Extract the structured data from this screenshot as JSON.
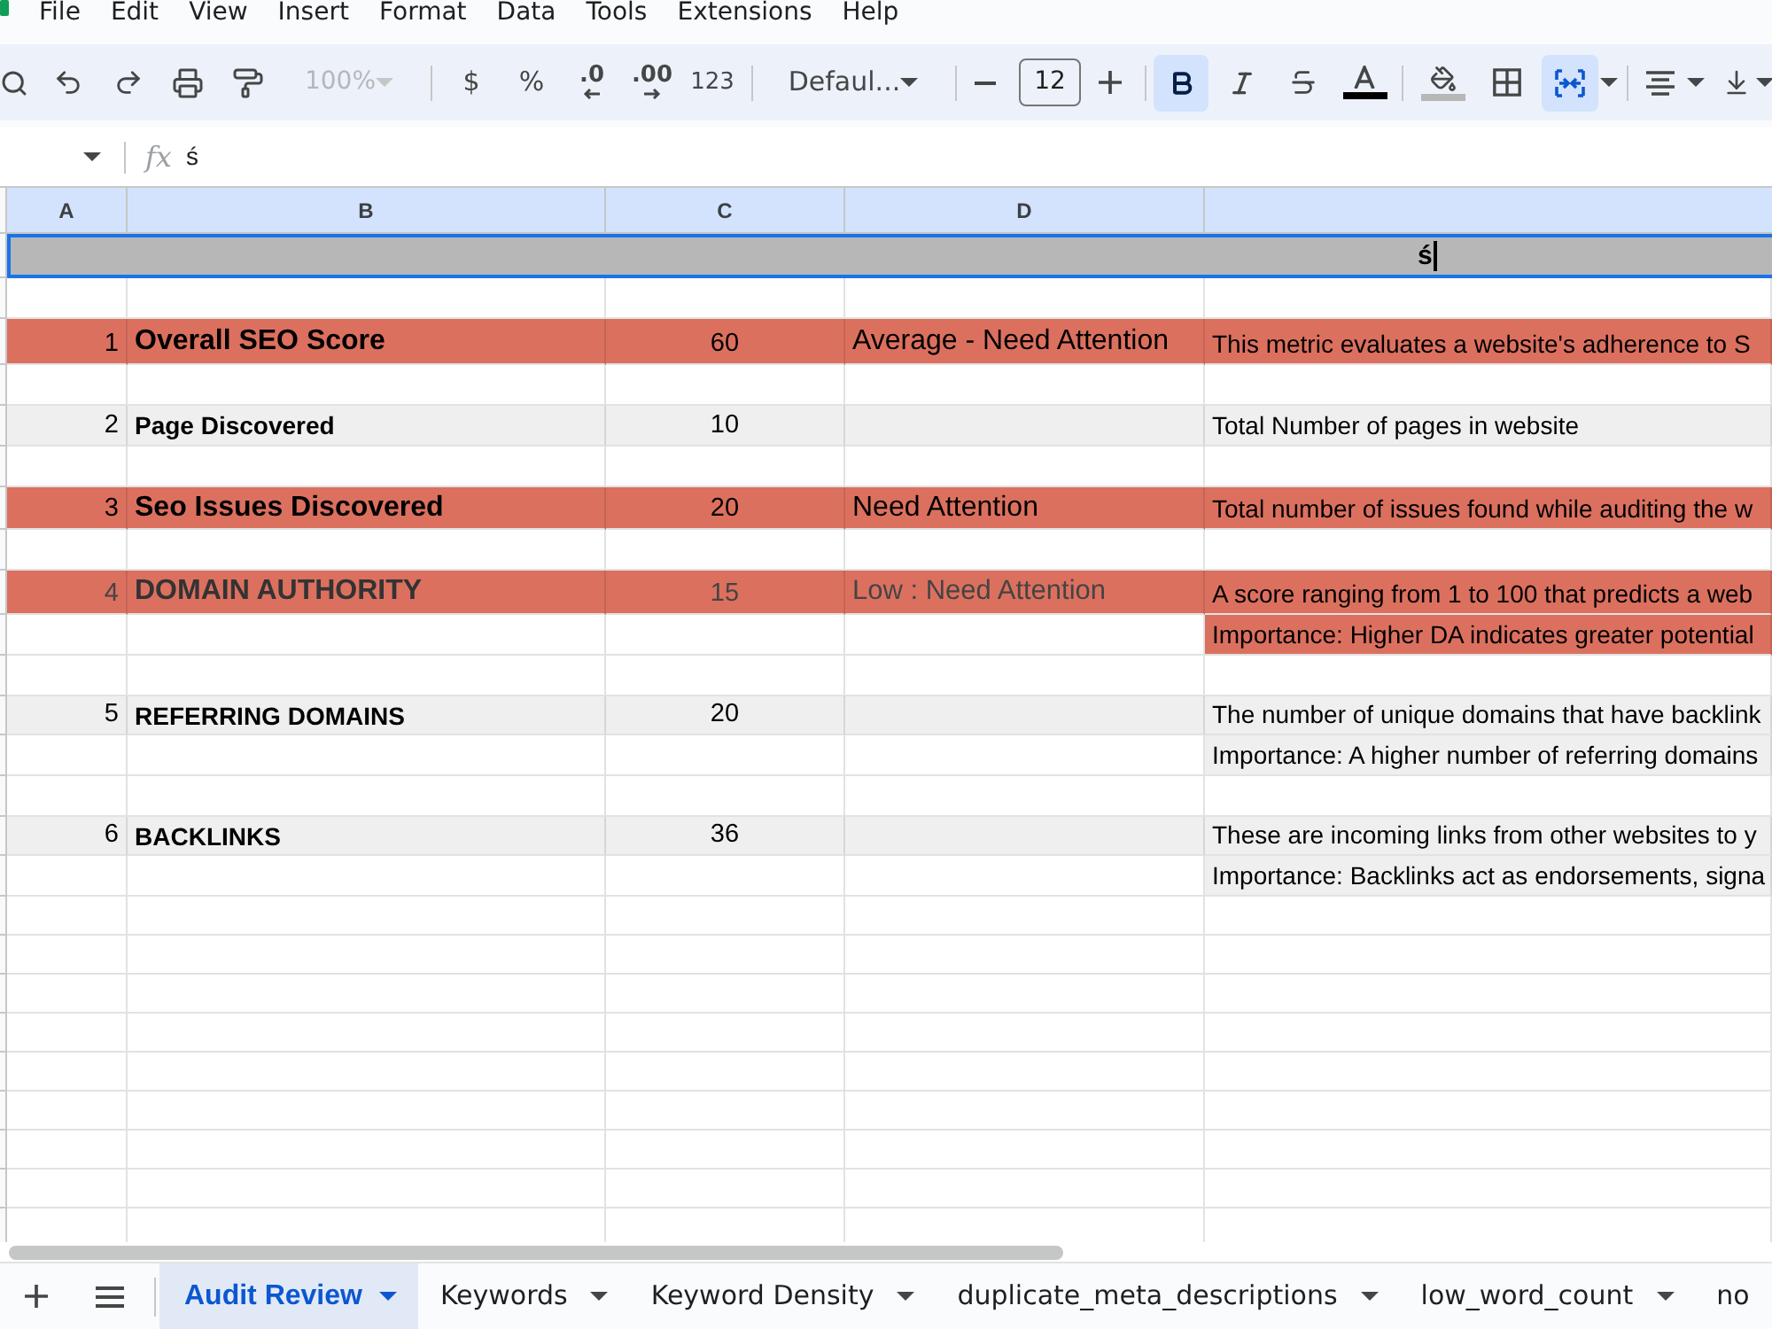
{
  "menu": [
    "File",
    "Edit",
    "View",
    "Insert",
    "Format",
    "Data",
    "Tools",
    "Extensions",
    "Help"
  ],
  "toolbar": {
    "zoom": {
      "label": "100%",
      "disabled": true
    },
    "number_formats": [
      {
        "kind": "symbol",
        "label": "$"
      },
      {
        "kind": "symbol",
        "label": "%"
      },
      {
        "kind": "decrease_decimals",
        "label": ".0"
      },
      {
        "kind": "increase_decimals",
        "label": ".00"
      },
      {
        "kind": "symbol",
        "label": "123"
      }
    ],
    "font_family": "Defaul...",
    "font_size": "12",
    "bold": {
      "selected": true
    },
    "italic": {
      "selected": false
    },
    "strikethrough": {
      "selected": false
    },
    "text_color": {
      "color": "#000000"
    },
    "fill_color": {
      "color": "#b7b7b7"
    },
    "merge": {
      "selected": true
    }
  },
  "formula_bar": {
    "fx": "fx",
    "value": "ś"
  },
  "sheet": {
    "columns": [
      "A",
      "B",
      "C",
      "D"
    ],
    "rows": [
      {
        "kind": "title",
        "text": "ś",
        "color": "#b7b7b7",
        "selected": true
      },
      {
        "kind": "spacer"
      },
      {
        "kind": "metric",
        "color": "#dc705f",
        "number": "1",
        "name": "Overall SEO Score",
        "value": "60",
        "status": "Average - Need Attention",
        "description": "This metric evaluates a website's adherence to S"
      },
      {
        "kind": "spacer"
      },
      {
        "kind": "metric",
        "color": "#efefef",
        "number": "2",
        "name": "Page Discovered",
        "value": "10",
        "description": "Total Number of pages in website"
      },
      {
        "kind": "spacer"
      },
      {
        "kind": "metric",
        "color": "#dc705f",
        "number": "3",
        "name": "Seo Issues Discovered",
        "value": "20",
        "status": "Need Attention",
        "description": "Total number of issues found while auditing the w"
      },
      {
        "kind": "spacer"
      },
      {
        "kind": "metric",
        "color": "#dc705f",
        "number": "4",
        "name": "DOMAIN AUTHORITY",
        "value": "15",
        "status": "Low : Need Attention",
        "description": "A score ranging from 1 to 100 that predicts a web"
      },
      {
        "kind": "note",
        "color": "#dc705f",
        "description": "Importance: Higher DA indicates greater potential"
      },
      {
        "kind": "spacer"
      },
      {
        "kind": "metric",
        "color": "#efefef",
        "number": "5",
        "name": "REFERRING DOMAINS",
        "value": "20",
        "description": "The number of unique domains that have backlink"
      },
      {
        "kind": "note",
        "color": "#efefef",
        "description": "Importance: A higher number of referring domains"
      },
      {
        "kind": "spacer"
      },
      {
        "kind": "metric",
        "color": "#efefef",
        "number": "6",
        "name": "BACKLINKS",
        "value": "36",
        "description": "These are incoming links from other websites to y"
      },
      {
        "kind": "note",
        "color": "#efefef",
        "description": "Importance: Backlinks act as endorsements, signa"
      }
    ]
  },
  "sheet_tabs": [
    {
      "label": "Audit Review",
      "selected": true
    },
    {
      "label": "Keywords",
      "selected": false
    },
    {
      "label": "Keyword Density",
      "selected": false
    },
    {
      "label": "duplicate_meta_descriptions",
      "selected": false
    },
    {
      "label": "low_word_count",
      "selected": false
    },
    {
      "label": "no",
      "selected": false
    }
  ]
}
